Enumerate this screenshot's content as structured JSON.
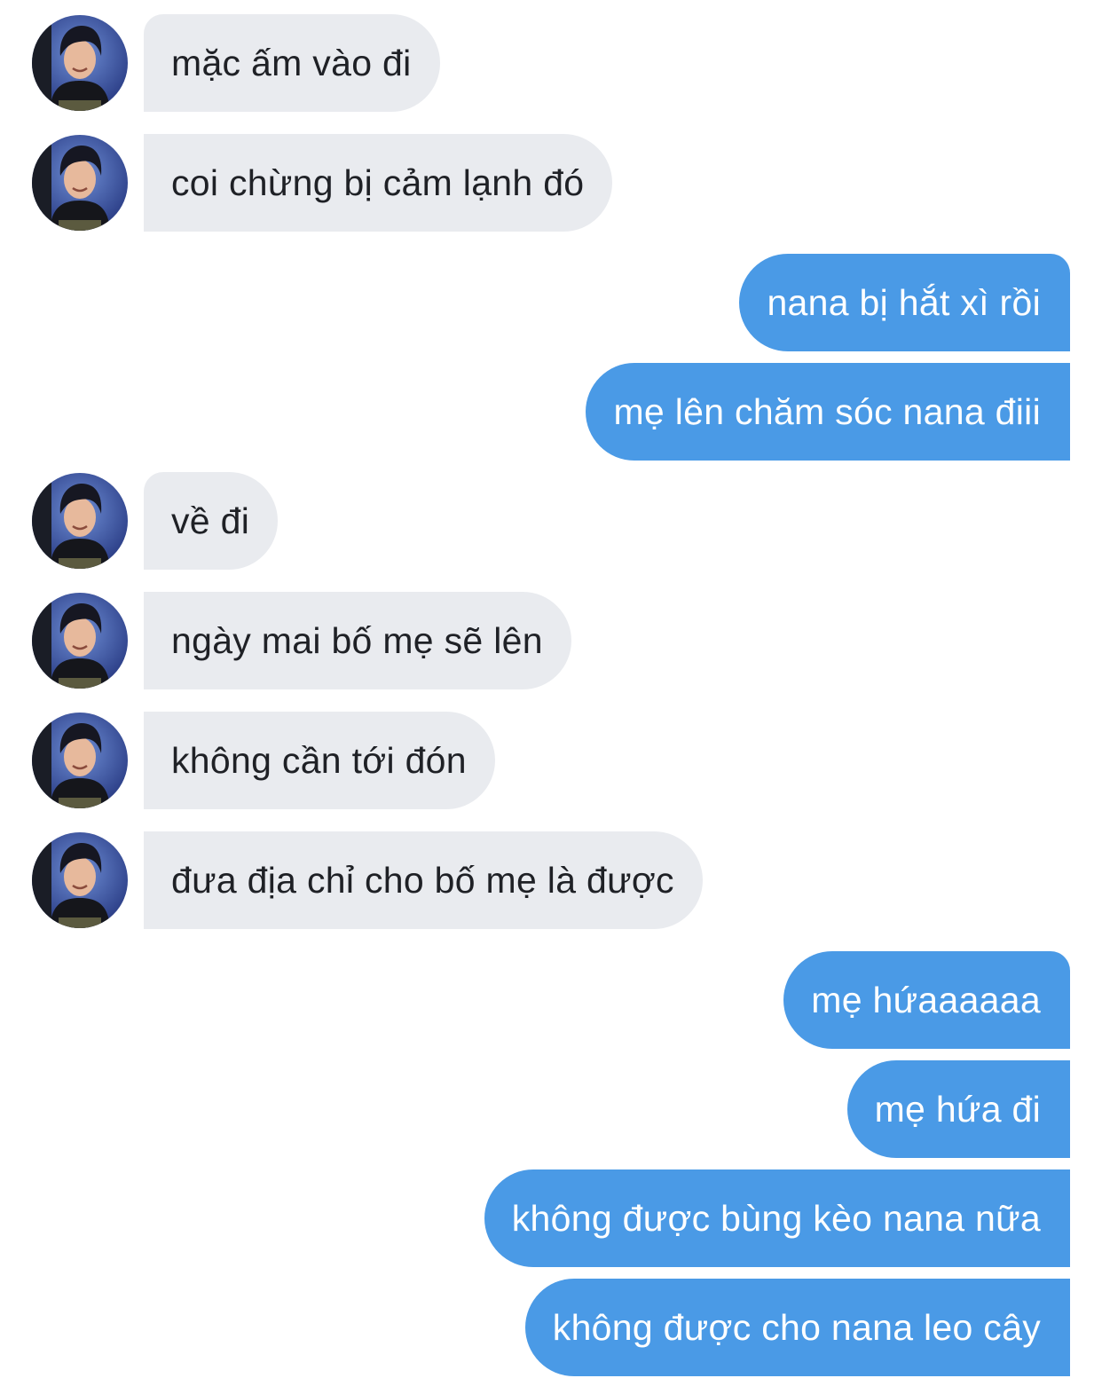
{
  "conversation": {
    "colors": {
      "incoming_bubble": "#e9ebef",
      "incoming_text": "#1f2126",
      "outgoing_bubble": "#4a9ae6",
      "outgoing_text": "#ffffff"
    },
    "contact_avatar_icon": "profile-photo-avatar",
    "messages": [
      {
        "direction": "incoming",
        "text": "mặc ấm vào đi"
      },
      {
        "direction": "incoming",
        "text": "coi chừng bị cảm lạnh đó"
      },
      {
        "direction": "outgoing",
        "text": "nana bị hắt xì rồi"
      },
      {
        "direction": "outgoing",
        "text": "mẹ lên chăm sóc nana điii"
      },
      {
        "direction": "incoming",
        "text": "về đi"
      },
      {
        "direction": "incoming",
        "text": "ngày mai bố mẹ sẽ lên"
      },
      {
        "direction": "incoming",
        "text": "không cần tới đón"
      },
      {
        "direction": "incoming",
        "text": "đưa địa chỉ cho bố mẹ là được"
      },
      {
        "direction": "outgoing",
        "text": "mẹ hứaaaaaa"
      },
      {
        "direction": "outgoing",
        "text": "mẹ hứa đi"
      },
      {
        "direction": "outgoing",
        "text": "không được bùng kèo nana nữa"
      },
      {
        "direction": "outgoing",
        "text": "không được cho nana leo cây"
      }
    ]
  }
}
